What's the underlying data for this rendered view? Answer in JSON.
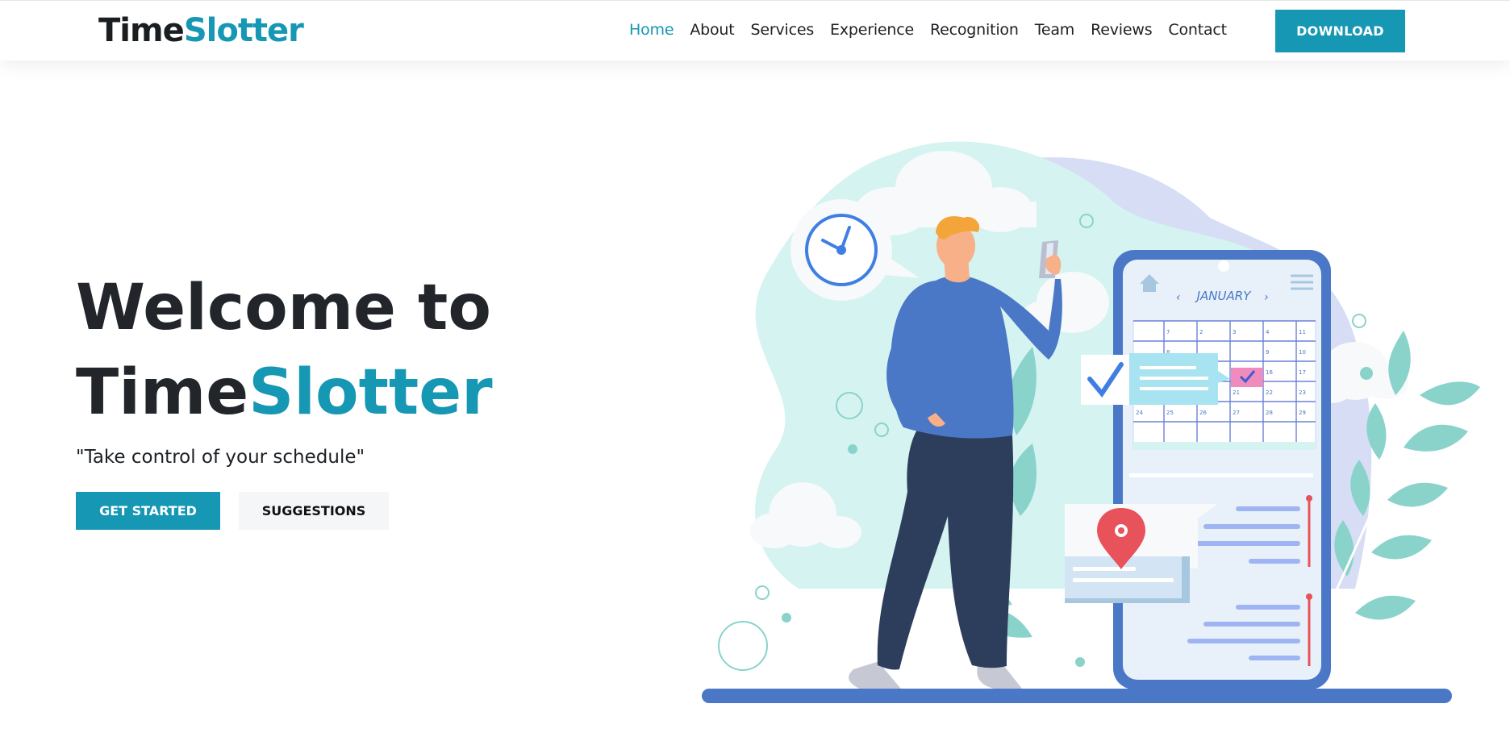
{
  "brand": {
    "name_part1": "Time",
    "name_part2": "Slotter"
  },
  "nav": {
    "items": [
      {
        "label": "Home",
        "active": true
      },
      {
        "label": "About"
      },
      {
        "label": "Services"
      },
      {
        "label": "Experience"
      },
      {
        "label": "Recognition"
      },
      {
        "label": "Team"
      },
      {
        "label": "Reviews"
      },
      {
        "label": "Contact"
      }
    ],
    "download_label": "DOWNLOAD"
  },
  "hero": {
    "title_line1": "Welcome to",
    "title_line2_part1": "Time",
    "title_line2_part2": "Slotter",
    "tagline": "\"Take control of your schedule\"",
    "primary_button": "GET STARTED",
    "secondary_button": "SUGGESTIONS"
  },
  "illustration": {
    "calendar_month": "JANUARY",
    "calendar_dates": [
      "7",
      "2",
      "3",
      "4",
      "8",
      "9",
      "10",
      "11",
      "16",
      "17",
      "21",
      "22",
      "23",
      "24",
      "25",
      "26",
      "27",
      "28",
      "29"
    ]
  },
  "colors": {
    "accent": "#1697b3",
    "dark_text": "#22262b",
    "illustration_blue": "#4a78c7",
    "illustration_mint": "#d5f3f1",
    "leaf_teal": "#8ad3cb",
    "pin_red": "#e8525a",
    "pink_highlight": "#f08bbd"
  }
}
